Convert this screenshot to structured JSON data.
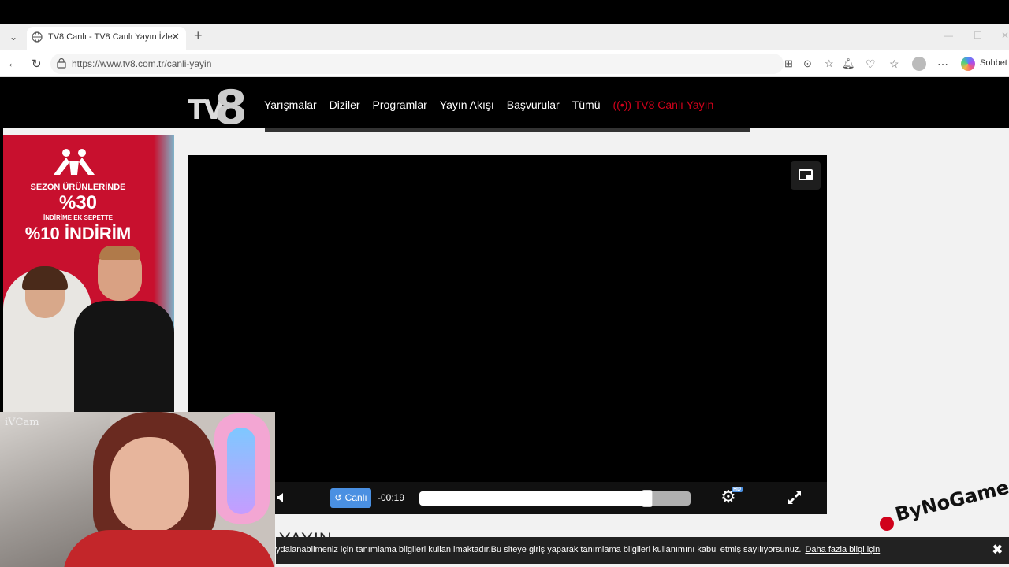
{
  "browser": {
    "tab_title": "TV8 Canlı - TV8 Canlı Yayın İzle",
    "url": "https://www.tv8.com.tr/canli-yayin",
    "sohbet_label": "Sohbet e"
  },
  "site": {
    "logo_tv": "TV",
    "logo_8": "8",
    "menu": [
      "Yarışmalar",
      "Diziler",
      "Programlar",
      "Yayın Akışı",
      "Başvurular",
      "Tümü"
    ],
    "live_link": "((•)) TV8 Canlı Yayın",
    "live_color": "#d0021b"
  },
  "ad": {
    "line1": "SEZON ÜRÜNLERİNDE",
    "line2": "%30",
    "line3": "İNDİRİME EK SEPETTE",
    "line4": "%10 İNDİRİM"
  },
  "player": {
    "live_button": "↺ Canlı",
    "time": "-00:19",
    "progress": 0.84,
    "hd_badge": "HD"
  },
  "page": {
    "section_title": "YAYIN",
    "cookie_text": "ydalanabilmeniz için tanımlama bilgileri kullanılmaktadır.Bu siteye giriş yaparak tanımlama bilgileri kullanımını kabul etmiş sayılıyorsunuz.",
    "cookie_link": "Daha fazla bilgi için",
    "cookie_close": "✖"
  },
  "overlay": {
    "webcam_label": "iVCam",
    "brand": "ByNoGame"
  }
}
